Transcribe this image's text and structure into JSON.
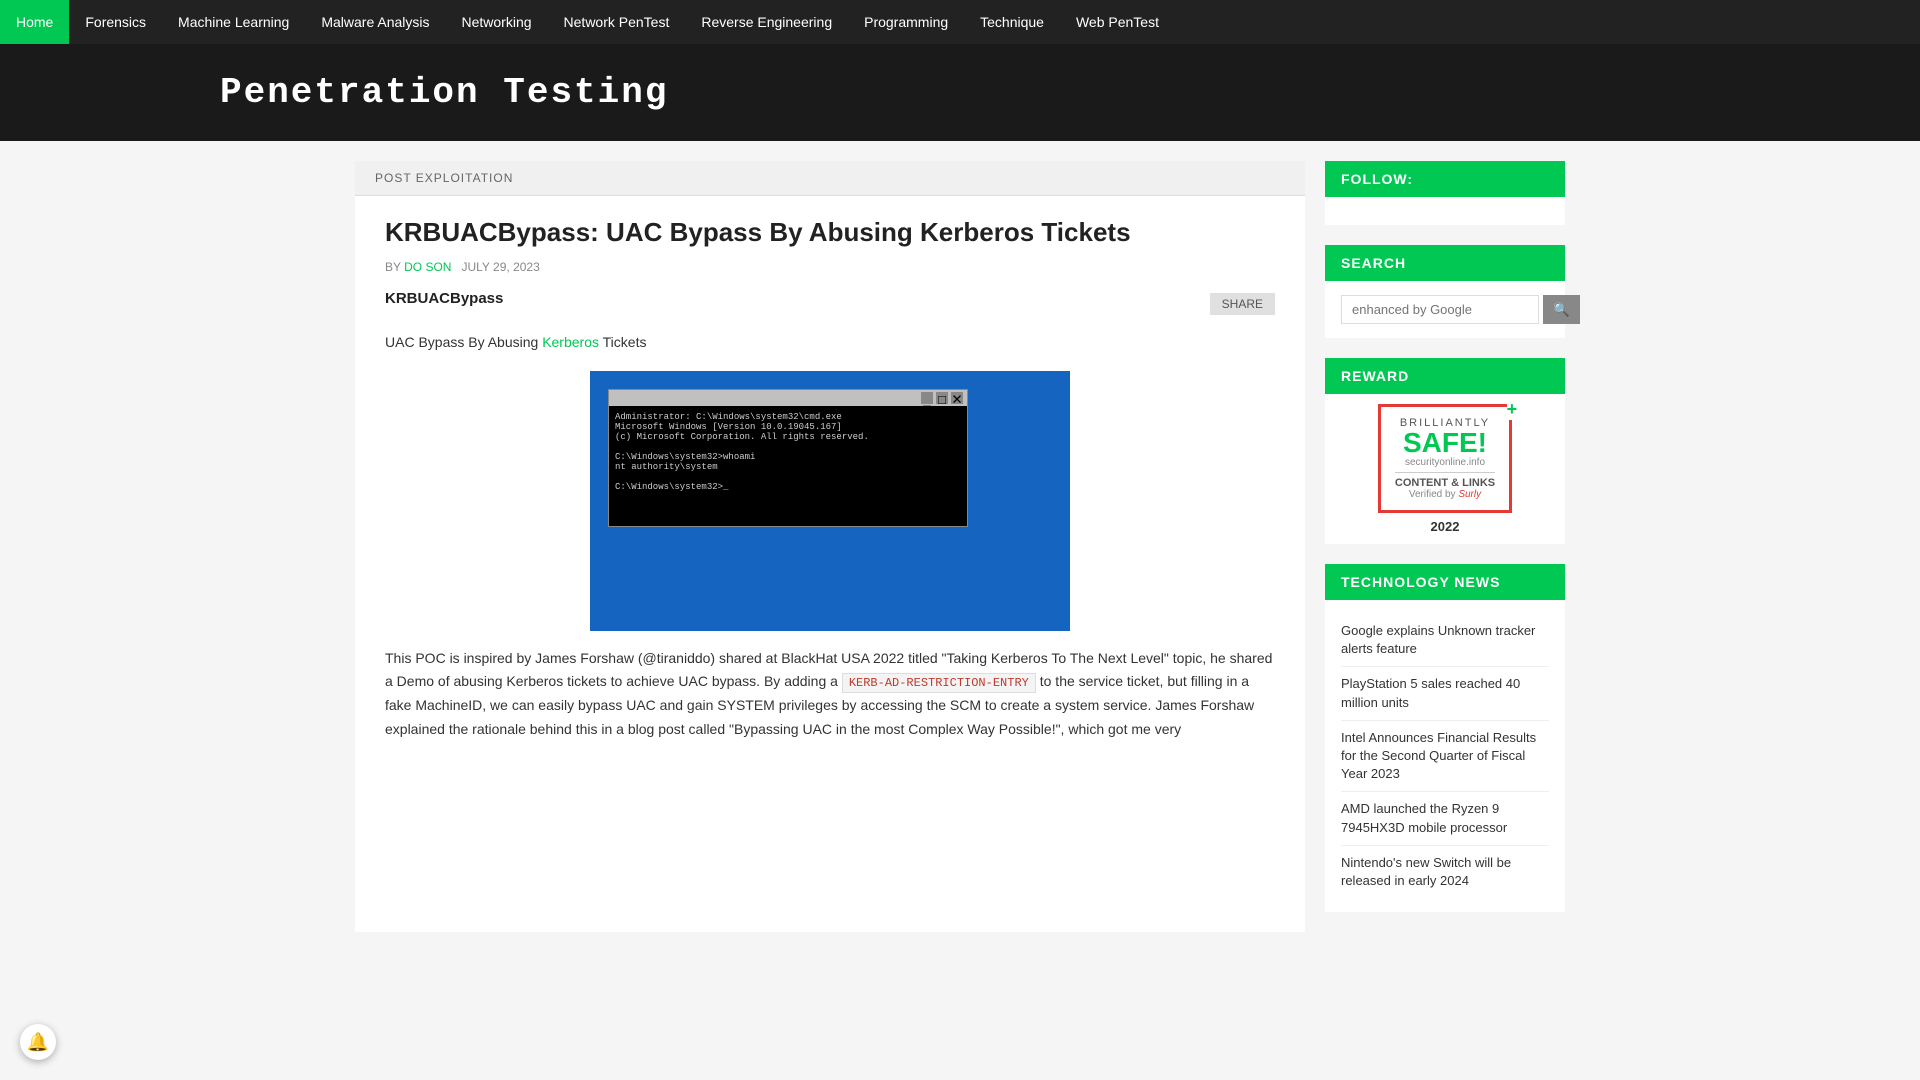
{
  "nav": {
    "items": [
      {
        "label": "Home",
        "active": false
      },
      {
        "label": "Forensics",
        "active": false
      },
      {
        "label": "Machine Learning",
        "active": false
      },
      {
        "label": "Malware Analysis",
        "active": false
      },
      {
        "label": "Networking",
        "active": false
      },
      {
        "label": "Network PenTest",
        "active": false
      },
      {
        "label": "Reverse Engineering",
        "active": false
      },
      {
        "label": "Programming",
        "active": false
      },
      {
        "label": "Technique",
        "active": false
      },
      {
        "label": "Web PenTest",
        "active": false
      }
    ]
  },
  "site": {
    "title": "Penetration Testing"
  },
  "breadcrumb": "POST EXPLOITATION",
  "article": {
    "title": "KRBUACBypass: UAC Bypass By Abusing Kerberos Tickets",
    "author": "DO SON",
    "date": "JULY 29, 2023",
    "intro": "KRBUACBypass",
    "share_label": "SHARE",
    "body1": "UAC Bypass By Abusing ",
    "kerberos_link": "Kerberos",
    "body1b": " Tickets",
    "terminal_text": "Administrator: C:\\Windows\\system32\\cmd.exe\r\nMicrosoft Windows [Version 10.0.19045.167]\r\n(c) Microsoft Corporation. All rights reserved.\r\n\r\nC:\\Windows\\system32>whoami\r\nnt authority\\system\r\n\r\nC:\\Windows\\system32>_",
    "body2": "This POC is inspired by James Forshaw (@tiraniddo) shared at BlackHat USA 2022 titled \"Taking Kerberos To The Next Level\" topic, he shared a Demo of abusing Kerberos tickets to achieve UAC bypass. By adding a ",
    "code_snippet": "KERB-AD-RESTRICTION-ENTRY",
    "body3": " to the service ticket, but filling in a fake MachineID, we can easily bypass UAC and gain SYSTEM privileges by accessing the SCM to create a system service. James Forshaw explained the rationale behind this in a blog post called \"Bypassing UAC in the most Complex Way Possible!\", which got me very"
  },
  "sidebar": {
    "follow_title": "FOLLOW:",
    "search_title": "SEARCH",
    "search_placeholder": "enhanced by Google",
    "search_btn": "search",
    "reward_title": "Reward",
    "reward": {
      "brilliantly": "BRILLIANTLY",
      "safe": "SAFE!",
      "site": "securityonline.info",
      "content": "CONTENT & LINKS",
      "verified": "Verified by",
      "surly": "Surly",
      "year": "2022"
    },
    "tech_news_title": "TECHNOLOGY NEWS",
    "tech_news": [
      {
        "label": "Google explains Unknown tracker alerts feature"
      },
      {
        "label": "PlayStation 5 sales reached 40 million units"
      },
      {
        "label": "Intel Announces Financial Results for the Second Quarter of Fiscal Year 2023"
      },
      {
        "label": "AMD launched the Ryzen 9 7945HX3D mobile processor"
      },
      {
        "label": "Nintendo's new Switch will be released in early 2024"
      }
    ]
  }
}
